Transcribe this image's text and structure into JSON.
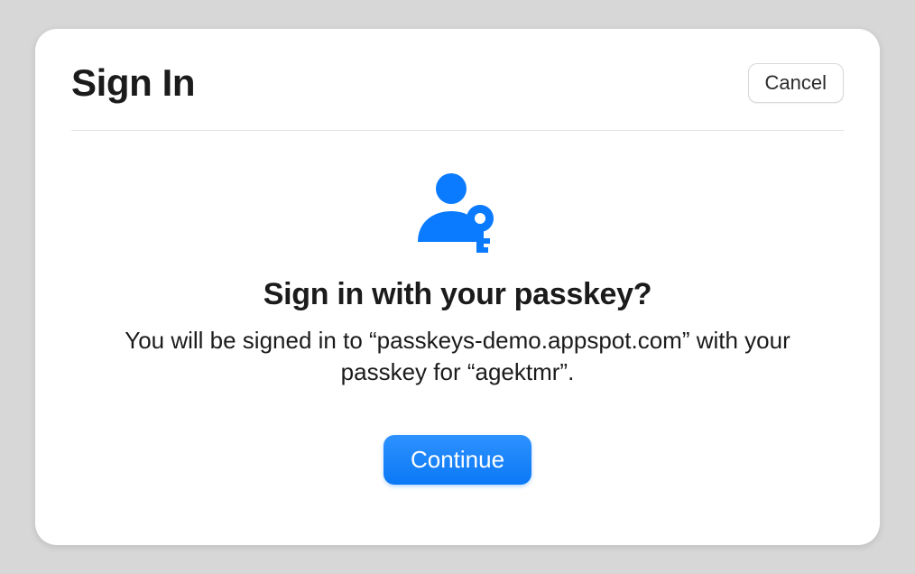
{
  "dialog": {
    "title": "Sign In",
    "cancel_label": "Cancel",
    "heading": "Sign in with your passkey?",
    "subtext": "You will be signed in to “passkeys-demo.appspot.com” with your passkey for “agektmr”.",
    "continue_label": "Continue",
    "accent_color": "#0A7BFF"
  }
}
